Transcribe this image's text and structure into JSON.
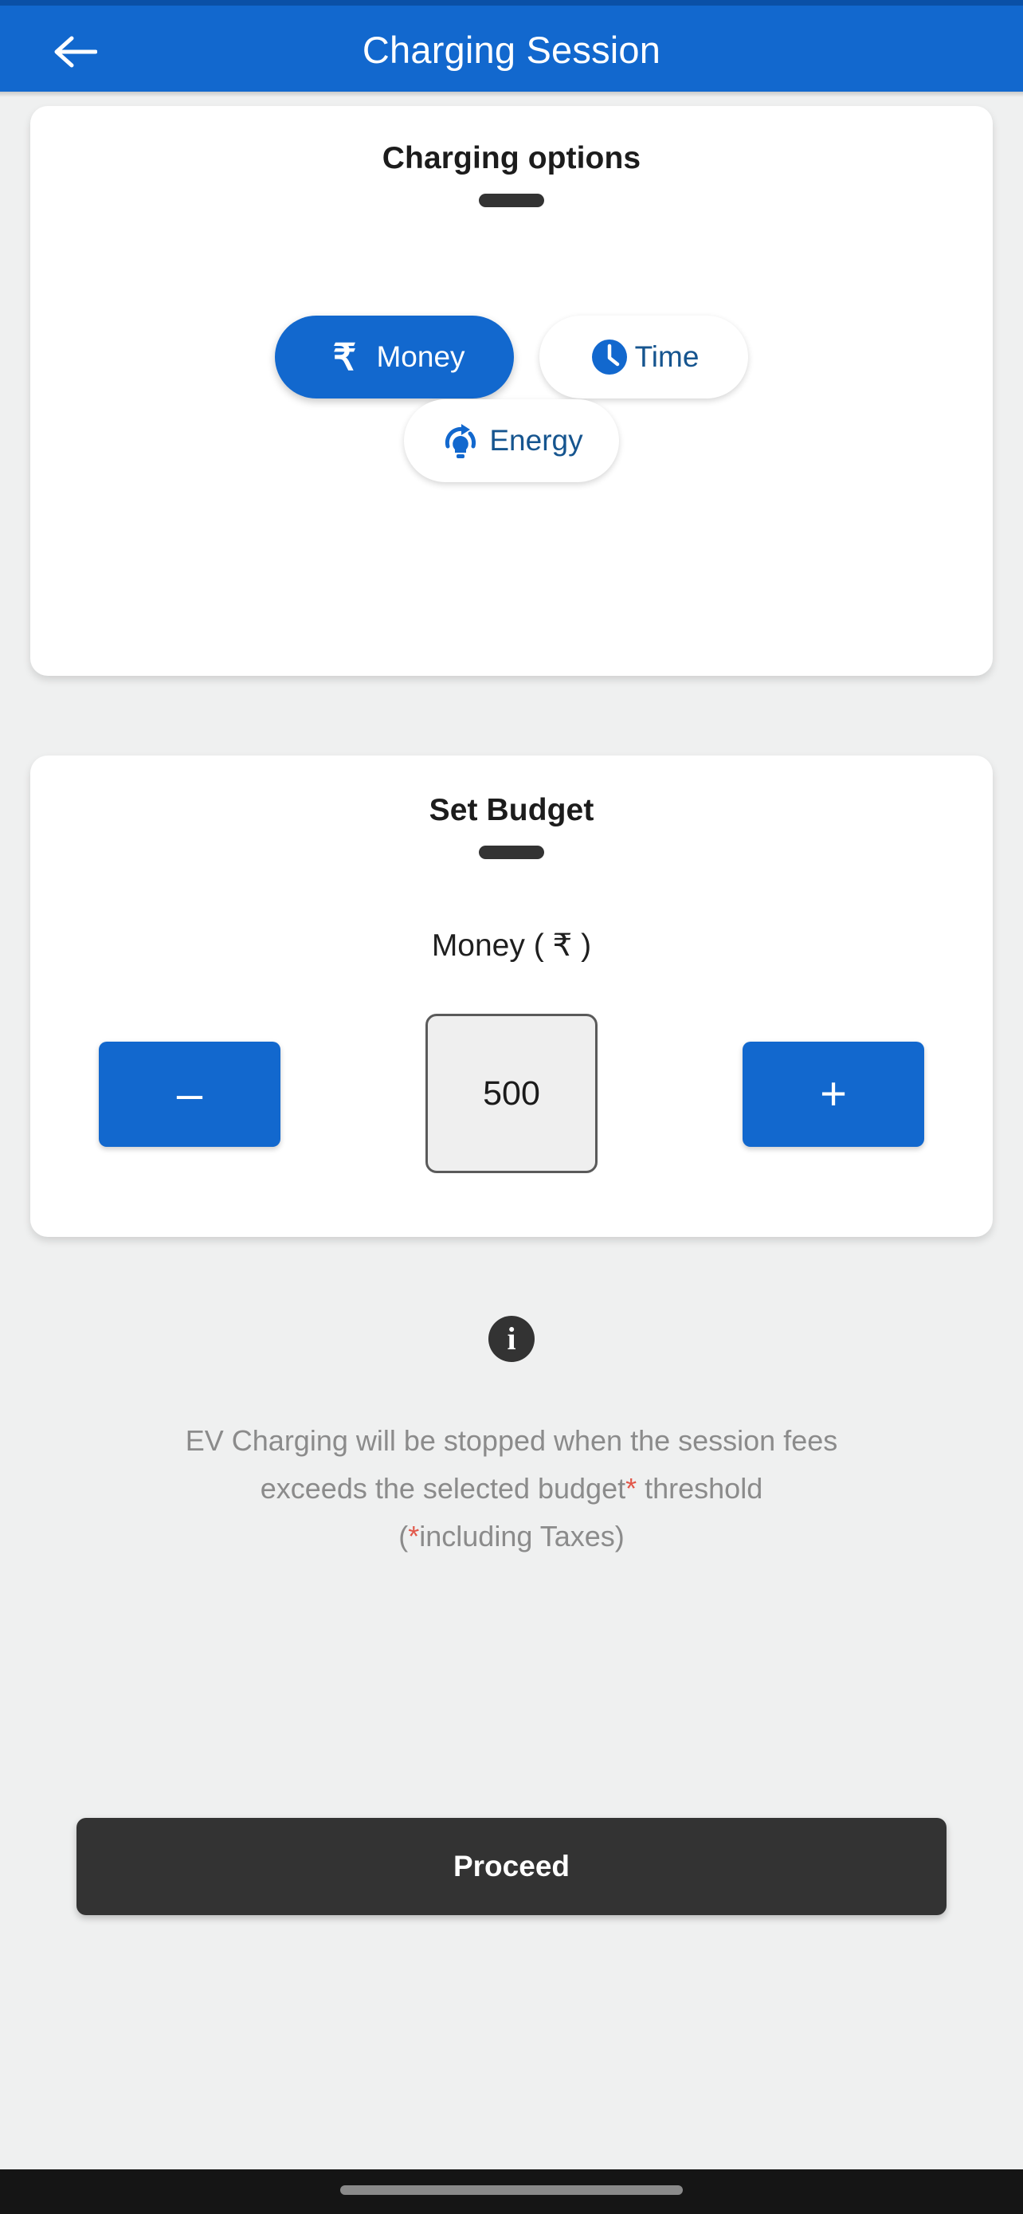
{
  "header": {
    "title": "Charging Session",
    "back_icon": "arrow-left-icon",
    "background_color": "#1268CE"
  },
  "charging_options": {
    "title": "Charging options",
    "options": [
      {
        "label": "Money",
        "icon": "rupee-icon",
        "selected": true
      },
      {
        "label": "Time",
        "icon": "clock-icon",
        "selected": false
      },
      {
        "label": "Energy",
        "icon": "energy-bulb-icon",
        "selected": false
      }
    ]
  },
  "set_budget": {
    "title": "Set Budget",
    "unit_label": "Money ( ₹ )",
    "value": "500",
    "decrement_label": "–",
    "increment_label": "+"
  },
  "disclaimer": {
    "icon": "info-icon",
    "line1_a": "EV Charging will be stopped when the session fees",
    "line2_a": "exceeds the selected budget",
    "line2_star": "*",
    "line2_b": " threshold",
    "line3_a": "(",
    "line3_star": "*",
    "line3_b": "including Taxes)"
  },
  "footer": {
    "proceed_label": "Proceed"
  },
  "colors": {
    "accent_blue": "#1268CE",
    "dark": "#333333",
    "asterisk_red": "#E2584A",
    "page_background": "#EFF0F0"
  }
}
